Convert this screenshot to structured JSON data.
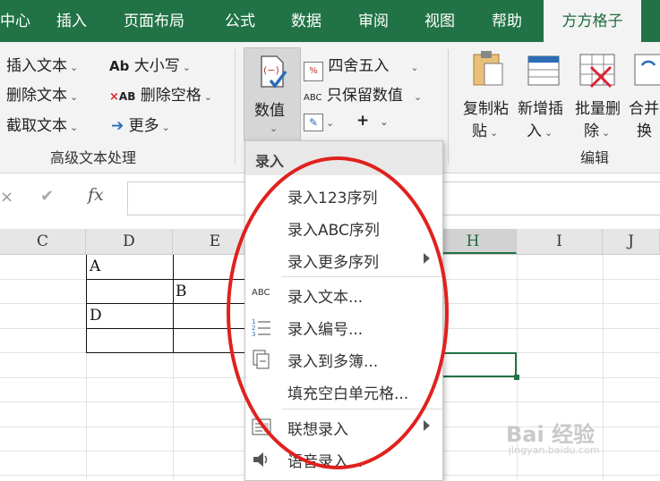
{
  "tabs": [
    {
      "label": "中心"
    },
    {
      "label": "插入"
    },
    {
      "label": "页面布局"
    },
    {
      "label": "公式"
    },
    {
      "label": "数据"
    },
    {
      "label": "审阅"
    },
    {
      "label": "视图"
    },
    {
      "label": "帮助"
    },
    {
      "label": "方方格子"
    }
  ],
  "ribbon": {
    "text_group": {
      "insert_text": "插入文本",
      "delete_text": "删除文本",
      "extract_text": "截取文本",
      "case_icon": "Ab",
      "case": "大小写",
      "delete_space_icon": "AB",
      "delete_space": "删除空格",
      "more": "更多",
      "label": "高级文本处理"
    },
    "number_group": {
      "numeric": "数值",
      "round": "四舍五入",
      "keep_numbers_icon": "ABC",
      "keep_numbers": "只保留数值",
      "plus": "+"
    },
    "edit_group": {
      "copy_paste_1": "复制粘",
      "copy_paste_2": "贴",
      "new_insert_1": "新增插",
      "new_insert_2": "入",
      "batch_delete_1": "批量删",
      "batch_delete_2": "除",
      "merge_1": "合并",
      "merge_2": "换",
      "label": "编辑"
    }
  },
  "formula_bar": {
    "fx": "fx"
  },
  "columns": [
    "C",
    "D",
    "E",
    "H",
    "I",
    "J"
  ],
  "cells": {
    "d1": "A",
    "e2": "B",
    "d3": "D"
  },
  "menu": {
    "header": "录入",
    "items": [
      {
        "label": "录入123序列"
      },
      {
        "label": "录入ABC序列"
      },
      {
        "label": "录入更多序列"
      },
      {
        "label": "录入文本..."
      },
      {
        "label": "录入编号..."
      },
      {
        "label": "录入到多簿..."
      },
      {
        "label": "填充空白单元格..."
      },
      {
        "label": "联想录入"
      },
      {
        "label": "语音录入..."
      }
    ],
    "text_icon": "ABC"
  },
  "watermark": {
    "text": "Bai 经验",
    "sub": "jingyan.baidu.com"
  },
  "colors": {
    "ribbon_green": "#217346",
    "annotation_red": "#e0211d"
  }
}
